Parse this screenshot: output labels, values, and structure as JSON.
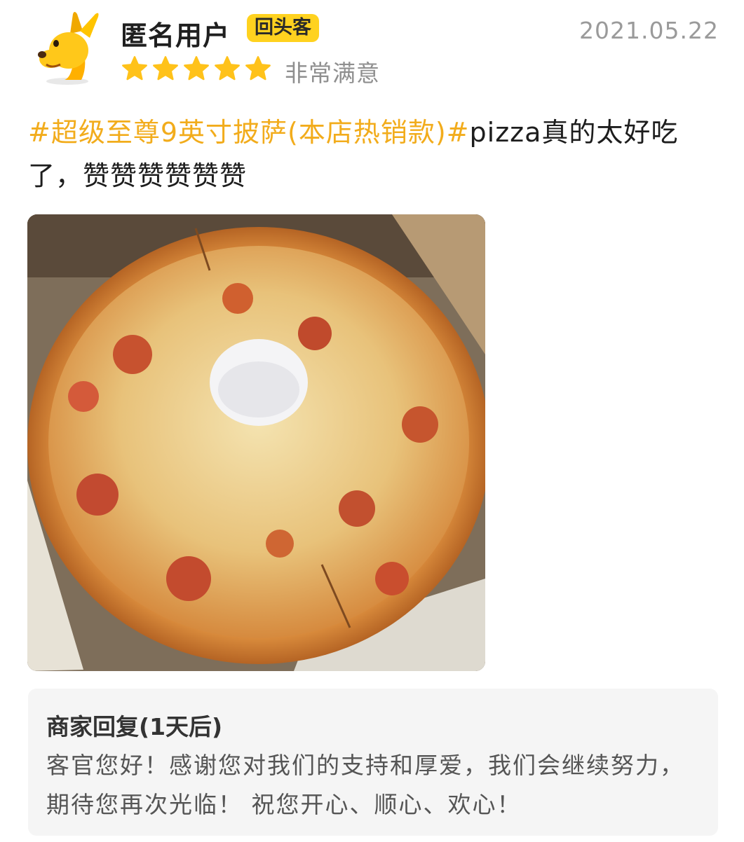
{
  "review": {
    "user_name": "匿名用户",
    "badge": "回头客",
    "date": "2021.05.22",
    "star_count": 5,
    "rating_text": "非常满意",
    "tag": "#超级至尊9英寸披萨(本店热销款)#",
    "text": "pizza真的太好吃了，赞赞赞赞赞赞",
    "icons": {
      "avatar": "yellow-dog-avatar",
      "star": "star-icon"
    },
    "colors": {
      "accent": "#f2ac1c",
      "badge_bg": "#ffd21f",
      "star": "#ffc21a"
    }
  },
  "merchant_reply": {
    "title": "商家回复(1天后)",
    "body": "客官您好！感谢您对我们的支持和厚爱，我们会继续努力，期待您再次光临！  祝您开心、顺心、欢心！"
  }
}
